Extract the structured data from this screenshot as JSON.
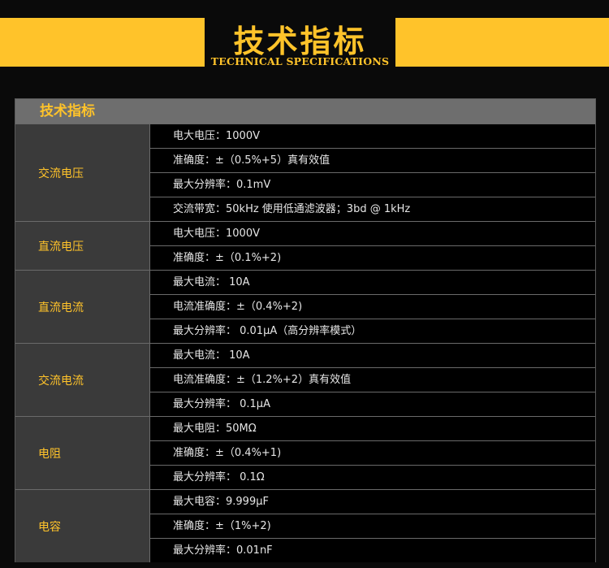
{
  "banner": {
    "title": "技术指标",
    "subtitle": "TECHNICAL SPECIFICATIONS"
  },
  "table": {
    "header": "技术指标",
    "groups": [
      {
        "label": "交流电压",
        "rows": [
          "电大电压：1000V",
          "准确度：±（0.5%+5）真有效值",
          "最大分辨率：0.1mV",
          "交流带宽：50kHz  使用低通滤波器；3bd @ 1kHz"
        ]
      },
      {
        "label": "直流电压",
        "rows": [
          "电大电压：1000V",
          "准确度：±（0.1%+2)"
        ]
      },
      {
        "label": "直流电流",
        "rows": [
          "最大电流： 10A",
          "电流准确度：±（0.4%+2)",
          "最大分辨率： 0.01μA（高分辨率模式）"
        ]
      },
      {
        "label": "交流电流",
        "rows": [
          "最大电流： 10A",
          "电流准确度：±（1.2%+2）真有效值",
          "最大分辨率： 0.1μA"
        ]
      },
      {
        "label": "电阻",
        "rows": [
          "最大电阻：50MΩ",
          "准确度：±（0.4%+1)",
          "最大分辨率： 0.1Ω"
        ]
      },
      {
        "label": "电容",
        "rows": [
          "最大电容：9.999μF",
          "准确度：±（1%+2)",
          "最大分辨率：0.01nF"
        ]
      }
    ]
  },
  "colors": {
    "accent": "#ffc32a",
    "background": "#0a0a0a",
    "label_cell": "#3a3a3a",
    "header_bar": "#6e6e6e"
  }
}
